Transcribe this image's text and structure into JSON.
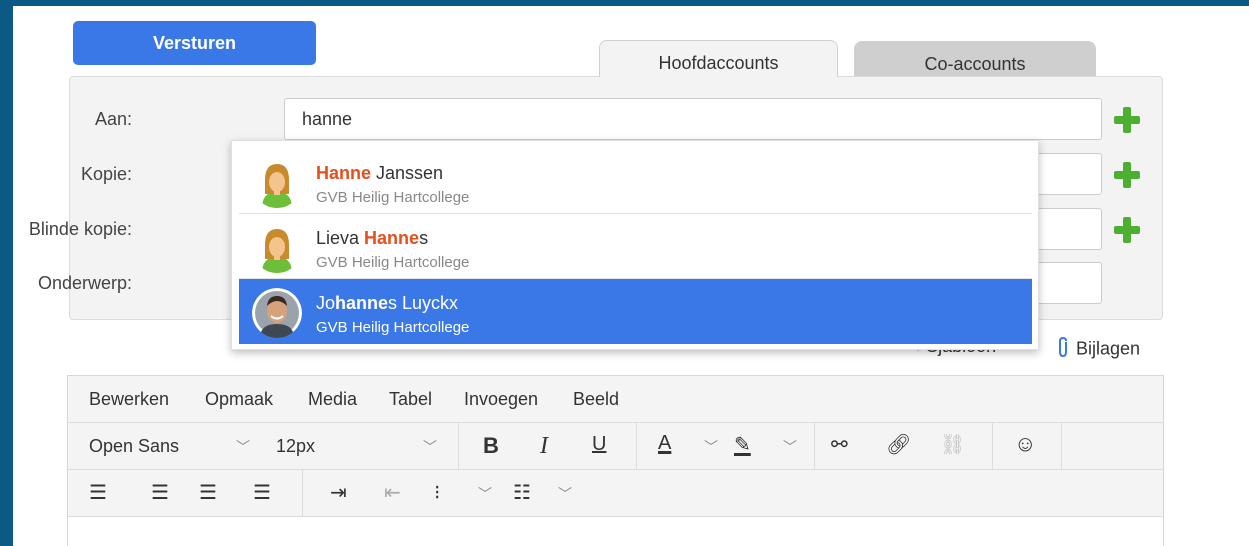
{
  "compose": {
    "send_label": "Versturen",
    "tabs": [
      "Hoofdaccounts",
      "Co-accounts"
    ],
    "labels": {
      "to": "Aan:",
      "cc": "Kopie:",
      "bcc": "Blinde kopie:",
      "subject": "Onderwerp:"
    },
    "to_value": "hanne"
  },
  "suggestions": [
    {
      "name_pre": "",
      "name_hl": "Hanne",
      "name_post": " Janssen",
      "org": "GVB Heilig Hartcollege",
      "avatar": "female-avatar-icon"
    },
    {
      "name_pre": "Lieva ",
      "name_hl": "Hanne",
      "name_post": "s",
      "org": "GVB Heilig Hartcollege",
      "avatar": "female-avatar-icon"
    },
    {
      "name_pre": "Jo",
      "name_hl": "hanne",
      "name_post": "s Luyckx",
      "org": "GVB Heilig Hartcollege",
      "avatar": "photo-avatar"
    }
  ],
  "links": {
    "template": "Sjabloon",
    "attachments": "Bijlagen"
  },
  "editor": {
    "menu": [
      "Bewerken",
      "Opmaak",
      "Media",
      "Tabel",
      "Invoegen",
      "Beeld"
    ],
    "font_family": "Open Sans",
    "font_size": "12px"
  },
  "colors": {
    "accent": "#3b78e7",
    "highlight": "#e84e1b",
    "add": "#4caf32",
    "frame": "#0b5a86"
  }
}
